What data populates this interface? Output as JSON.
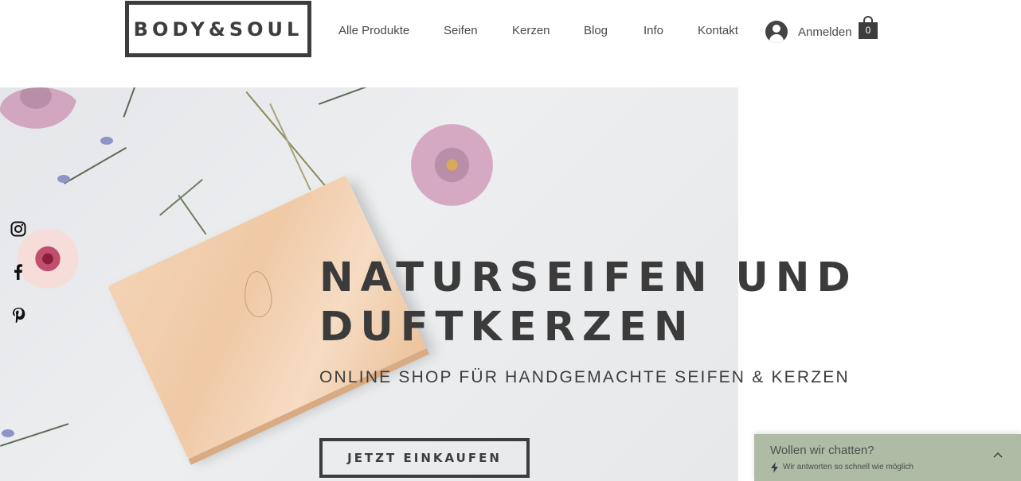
{
  "header": {
    "logo_text": "BODY&SOUL",
    "nav": [
      {
        "label": "Alle Produkte"
      },
      {
        "label": "Seifen"
      },
      {
        "label": "Kerzen"
      },
      {
        "label": "Blog"
      },
      {
        "label": "Info"
      },
      {
        "label": "Kontakt"
      }
    ],
    "login_label": "Anmelden",
    "cart_count": "0"
  },
  "social": [
    {
      "icon": "instagram-icon"
    },
    {
      "icon": "facebook-icon"
    },
    {
      "icon": "pinterest-icon"
    }
  ],
  "hero": {
    "title": "NATURSEIFEN UND DUFTKERZEN",
    "subtitle": "ONLINE SHOP FÜR HANDGEMACHTE SEIFEN & KERZEN",
    "cta_label": "JETZT EINKAUFEN"
  },
  "chat": {
    "title": "Wollen wir chatten?",
    "subtitle": "Wir antworten so schnell wie möglich"
  },
  "colors": {
    "text_dark": "#3d3d3d",
    "chat_bg": "#aebca6",
    "hero_bg": "#e4e6e9"
  }
}
